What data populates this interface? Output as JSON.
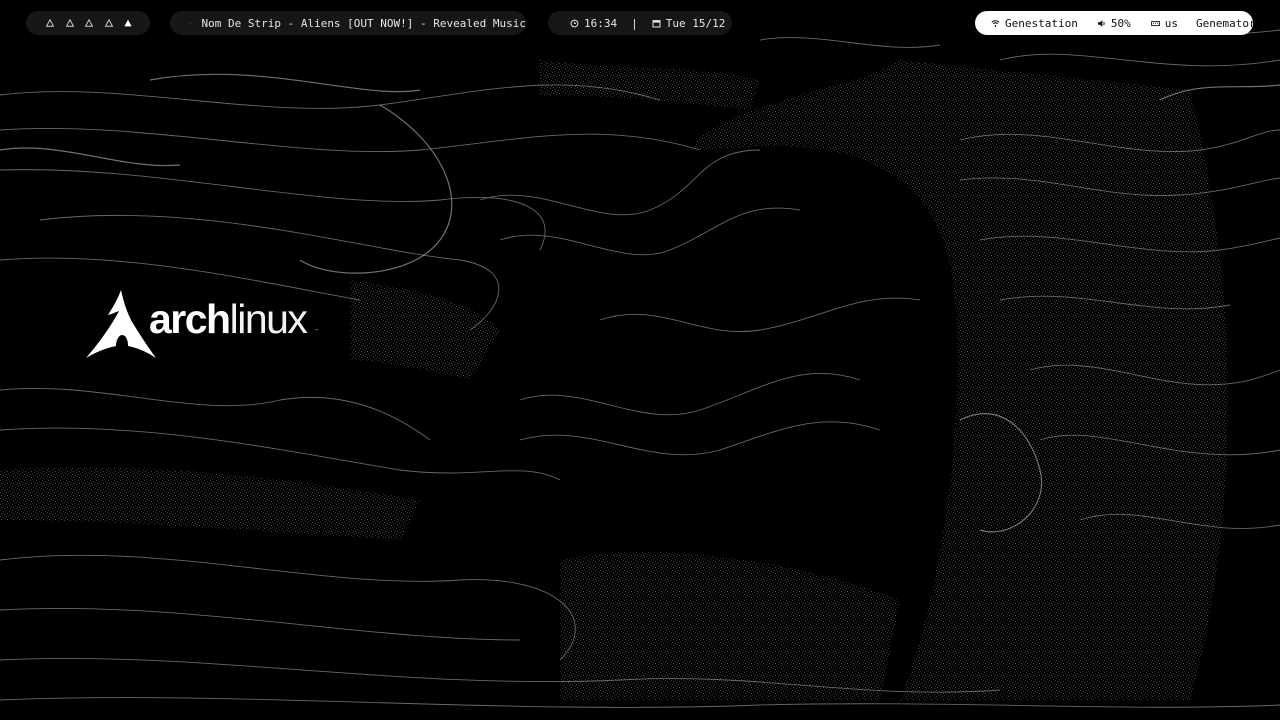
{
  "desktop": {
    "logo": {
      "word_bold": "arch",
      "word_light": "linux",
      "trademark": "™",
      "icon": "arch-linux-logo"
    }
  },
  "topbar": {
    "workspaces": {
      "items": [
        {
          "icon": "triangle-outline",
          "active": false
        },
        {
          "icon": "triangle-outline",
          "active": false
        },
        {
          "icon": "triangle-outline",
          "active": false
        },
        {
          "icon": "triangle-outline",
          "active": false
        },
        {
          "icon": "triangle-filled",
          "active": true
        }
      ]
    },
    "media": {
      "icon": "music-note-icon",
      "now_playing": "Nom De Strip - Aliens [OUT NOW!] - Revealed Music"
    },
    "clock": {
      "time_icon": "clock-icon",
      "time": "16:34",
      "separator": "|",
      "date_icon": "calendar-icon",
      "date": "Tue 15/12"
    },
    "status": {
      "network_icon": "wifi-icon",
      "network": "Genestation",
      "volume_icon": "speaker-icon",
      "volume": "50%",
      "keyboard_icon": "keyboard-icon",
      "keyboard_layout": "us",
      "user": "Genemator"
    }
  },
  "colors": {
    "bar_dark": "#181818",
    "bar_light": "#ffffff",
    "background": "#000000",
    "text_light": "#e6e6e6",
    "text_dark": "#111111"
  }
}
